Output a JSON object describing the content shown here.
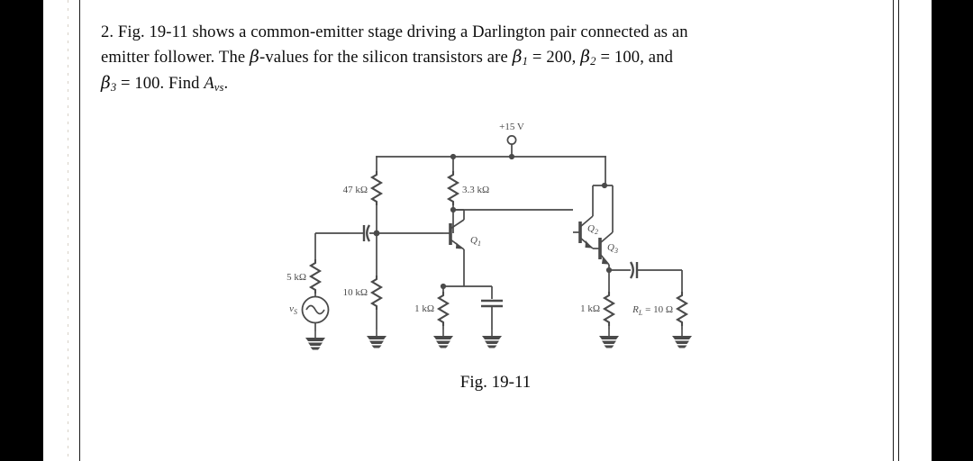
{
  "page": {
    "background_color": "#ffffff",
    "edge_band_color": "#000000",
    "rule_color": "#1a1a1a",
    "ink_color": "#4a4a4a",
    "text_color": "#0d0d0d"
  },
  "problem": {
    "number": "2.",
    "line1_a": "Fig. 19-11 shows a common-emitter stage driving a Darlington pair connected as an",
    "line2_a": "emitter follower. The ",
    "line2_beta": "β",
    "line2_b": "-values for the silicon transistors are ",
    "line2_b1_sym": "β",
    "line2_b1_sub": "1",
    "line2_b1_eq": " = ",
    "line2_b1_val": "200,",
    "line2_b2_sym": "β",
    "line2_b2_sub": "2",
    "line2_b2_eq": " = ",
    "line2_b2_val": "100, and",
    "line3_b3_sym": "β",
    "line3_b3_sub": "3",
    "line3_b3_eq": " = 100. Find ",
    "line3_av_sym": "A",
    "line3_av_sub": "vs",
    "line3_end": "."
  },
  "figure": {
    "caption": "Fig. 19-11",
    "supply_label": "+15 V",
    "source_label_sym": "v",
    "source_label_sub": "S",
    "components": {
      "r_source": "5 kΩ",
      "r_bias_upper": "47 kΩ",
      "r_bias_lower": "10 kΩ",
      "r_collector": "3.3 kΩ",
      "r_emitter_q1": "1 kΩ",
      "r_emitter_darlington": "1 kΩ",
      "r_load_sym": "R",
      "r_load_sub": "L",
      "r_load_eq": " = ",
      "r_load_val": "10 Ω"
    },
    "transistors": [
      {
        "sym": "Q",
        "sub": "1"
      },
      {
        "sym": "Q",
        "sub": "2"
      },
      {
        "sym": "Q",
        "sub": "3"
      }
    ]
  }
}
